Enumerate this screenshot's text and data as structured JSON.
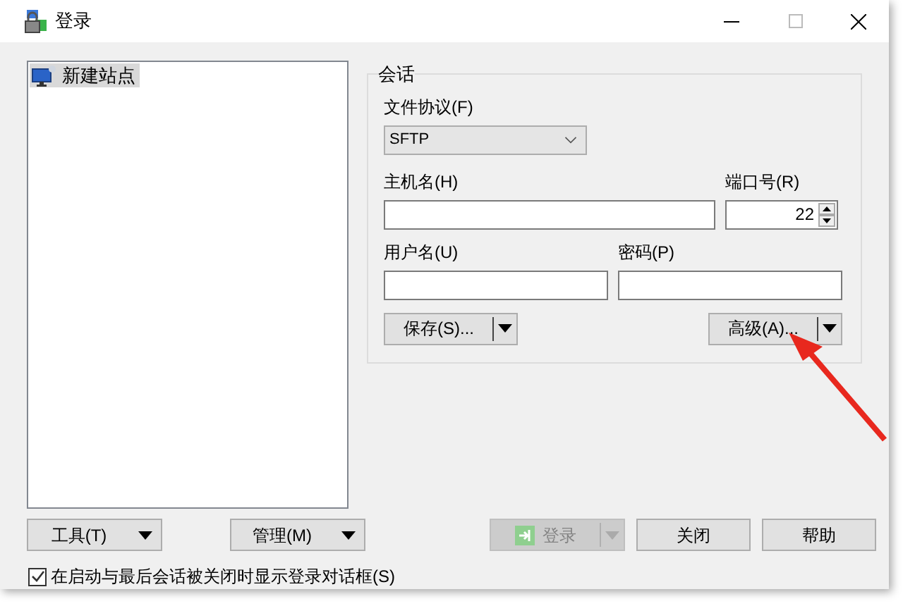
{
  "window": {
    "title": "登录"
  },
  "sites": [
    {
      "label": "新建站点",
      "selected": true
    }
  ],
  "session": {
    "title": "会话",
    "protocol": {
      "label": "文件协议(F)",
      "value": "SFTP"
    },
    "host": {
      "label": "主机名(H)"
    },
    "port": {
      "label": "端口号(R)",
      "value": "22"
    },
    "user": {
      "label": "用户名(U)"
    },
    "password": {
      "label": "密码(P)"
    },
    "buttons": [
      {
        "label": "保存(S)...",
        "kind": "split"
      },
      {
        "label": "高级(A)...",
        "kind": "split"
      }
    ]
  },
  "left_buttons": [
    {
      "label": "工具(T)",
      "kind": "menu"
    },
    {
      "label": "管理(M)",
      "kind": "menu"
    }
  ],
  "dialog_buttons": [
    {
      "label": "登录",
      "kind": "split",
      "disabled": true
    },
    {
      "label": "关闭",
      "kind": "plain",
      "disabled": false
    },
    {
      "label": "帮助",
      "kind": "plain",
      "disabled": false
    }
  ],
  "startup_checkbox": {
    "label": "在启动与最后会话被关闭时显示登录对话框(S)",
    "checked": true
  }
}
